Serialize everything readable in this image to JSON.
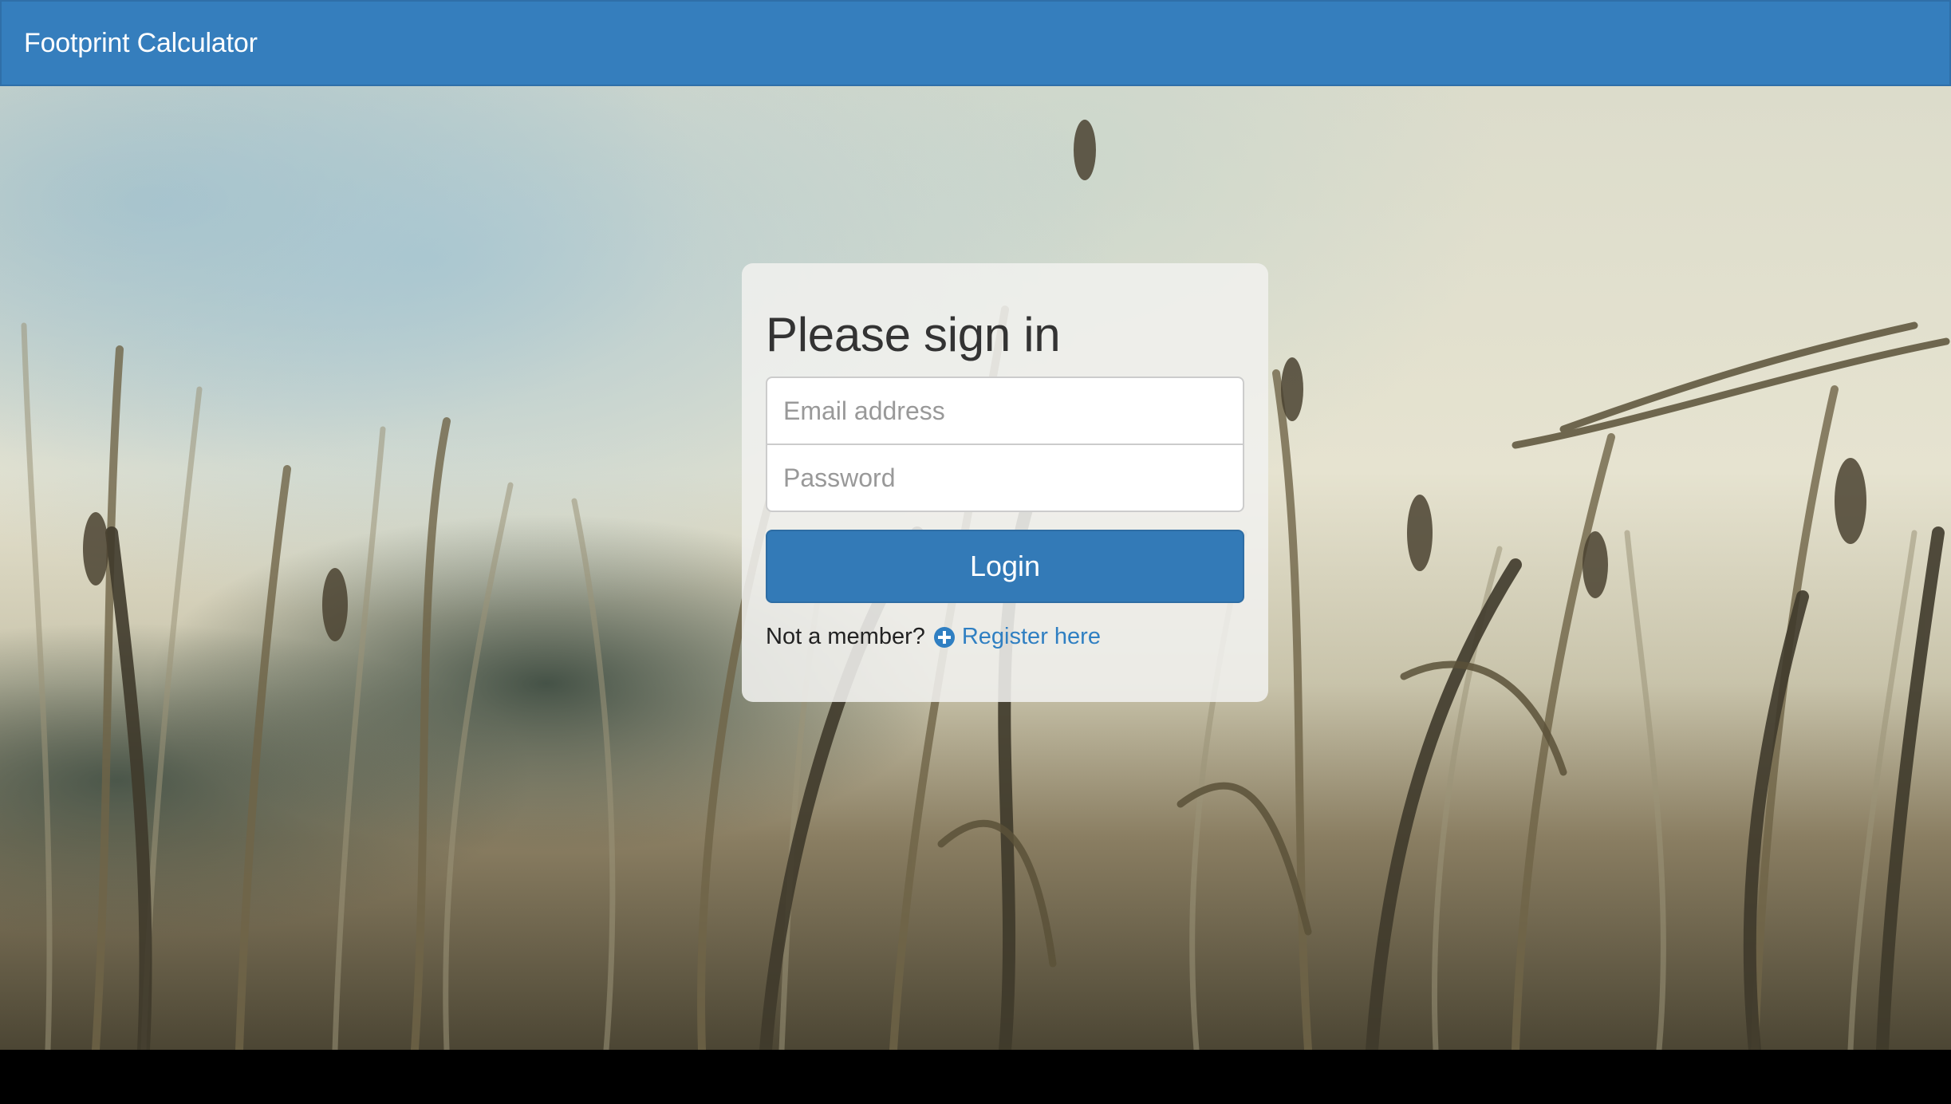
{
  "navbar": {
    "brand": "Footprint Calculator"
  },
  "login": {
    "title": "Please sign in",
    "email_placeholder": "Email address",
    "password_placeholder": "Password",
    "submit_label": "Login",
    "not_member_text": "Not a member?",
    "register_label": "Register here",
    "register_icon": "plus-circle-icon"
  },
  "colors": {
    "navbar": "#357ebd",
    "primary_button": "#337ab7",
    "link": "#2f7fc2"
  }
}
